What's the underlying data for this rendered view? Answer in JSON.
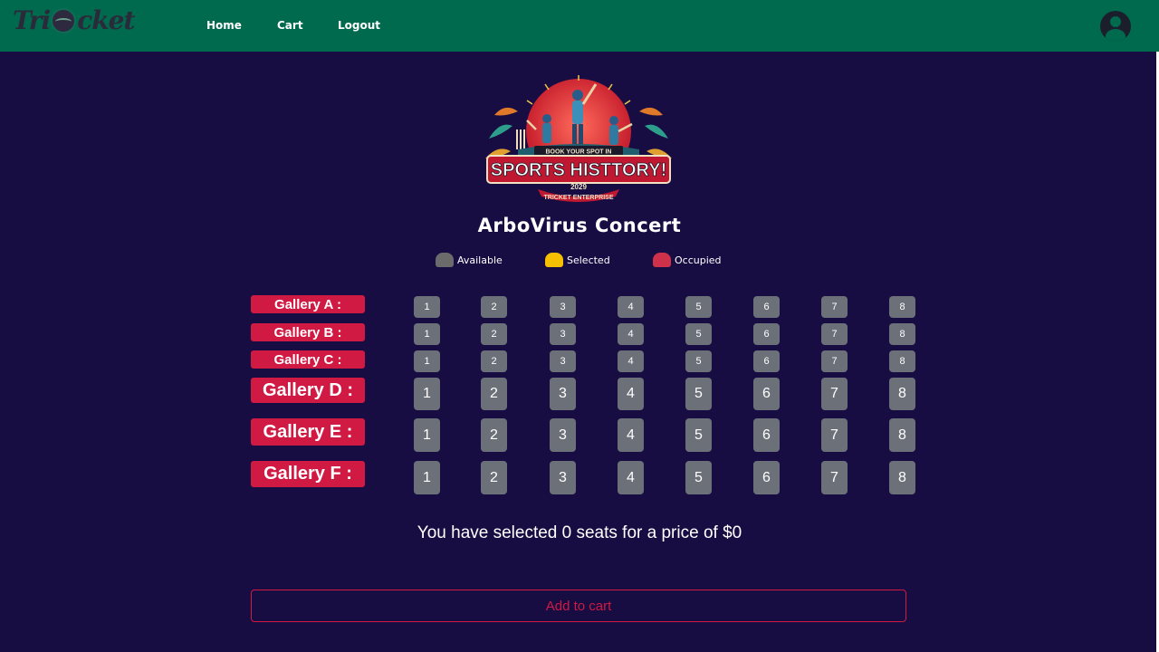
{
  "nav": {
    "logo_left": "Tri",
    "logo_right": "cket",
    "links": [
      "Home",
      "Cart",
      "Logout"
    ]
  },
  "banner": {
    "line1": "BOOK YOUR SPOT IN",
    "line2": "SPORTS HISTTORY!",
    "year": "2029",
    "line3": "TRICKET ENTERPRISE"
  },
  "event": {
    "title": "ArboVirus Concert"
  },
  "legend": [
    {
      "label": "Available",
      "color": "#6b6b6b"
    },
    {
      "label": "Selected",
      "color": "#f5c000"
    },
    {
      "label": "Occupied",
      "color": "#d0314a"
    }
  ],
  "galleries": [
    {
      "label": "Gallery A :",
      "seats": [
        "1",
        "2",
        "3",
        "4",
        "5",
        "6",
        "7",
        "8"
      ]
    },
    {
      "label": "Gallery B :",
      "seats": [
        "1",
        "2",
        "3",
        "4",
        "5",
        "6",
        "7",
        "8"
      ]
    },
    {
      "label": "Gallery C :",
      "seats": [
        "1",
        "2",
        "3",
        "4",
        "5",
        "6",
        "7",
        "8"
      ]
    },
    {
      "label": "Gallery D :",
      "seats": [
        "1",
        "2",
        "3",
        "4",
        "5",
        "6",
        "7",
        "8"
      ]
    },
    {
      "label": "Gallery E :",
      "seats": [
        "1",
        "2",
        "3",
        "4",
        "5",
        "6",
        "7",
        "8"
      ]
    },
    {
      "label": "Gallery F :",
      "seats": [
        "1",
        "2",
        "3",
        "4",
        "5",
        "6",
        "7",
        "8"
      ]
    }
  ],
  "summary": "You have selected 0 seats for a price of $0",
  "cart_button": "Add to cart",
  "colors": {
    "nav": "#006a4e",
    "background": "#170d42",
    "accent": "#d01943",
    "seat": "#6b7079"
  }
}
